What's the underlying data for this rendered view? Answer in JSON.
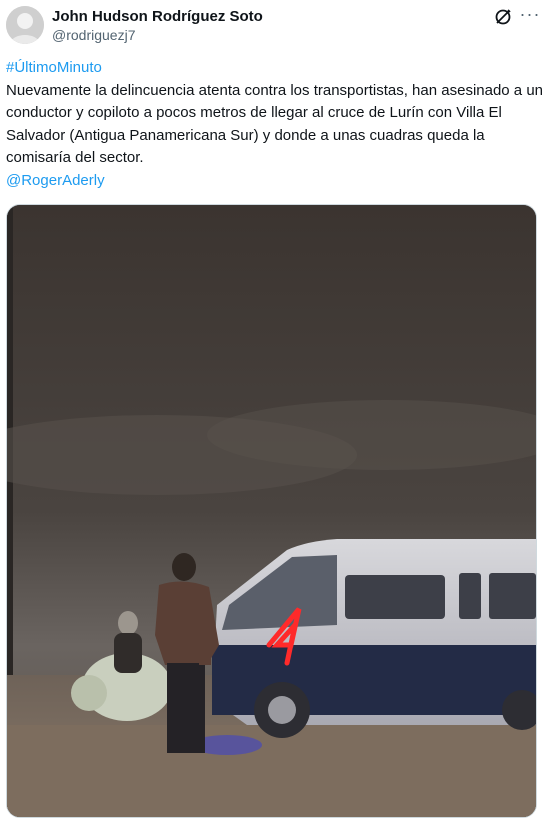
{
  "author": {
    "name": "John Hudson Rodríguez Soto",
    "handle": "@rodriguezj7"
  },
  "tweet": {
    "hashtag": "#ÚltimoMinuto",
    "body": "Nuevamente la delincuencia atenta contra los transportistas, han asesinado a un conductor y copiloto a pocos metros de llegar al cruce de Lurín con Villa El Salvador (Antigua Panamericana Sur) y donde a unas cuadras queda la comisaría del sector.",
    "mention": "@RogerAderly"
  },
  "icons": {
    "grok": "grok-icon",
    "more": "more-options-icon"
  },
  "colors": {
    "link": "#1d9bf0",
    "text": "#0f1419",
    "secondary": "#536471"
  }
}
